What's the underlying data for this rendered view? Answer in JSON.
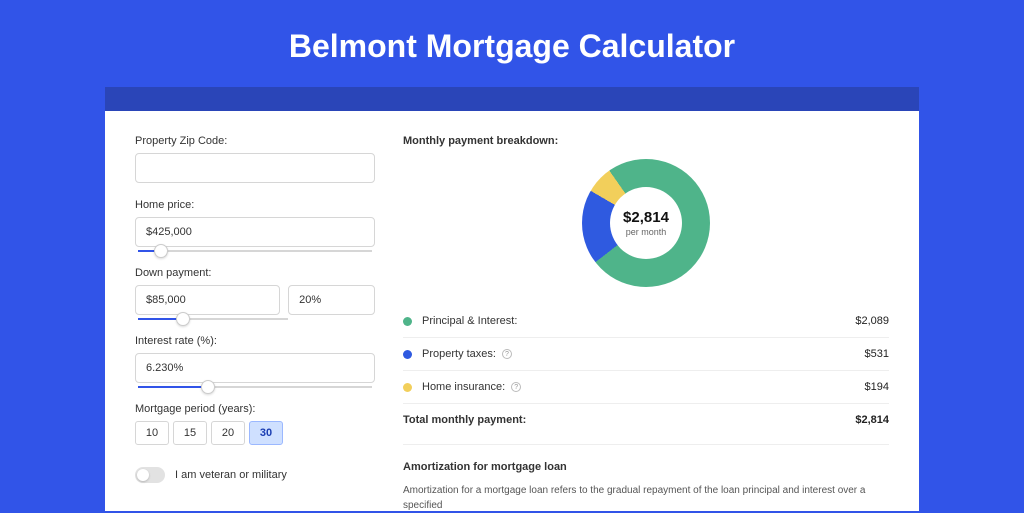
{
  "title": "Belmont Mortgage Calculator",
  "form": {
    "zip": {
      "label": "Property Zip Code:",
      "value": ""
    },
    "home_price": {
      "label": "Home price:",
      "value": "$425,000",
      "slider_pct": 10
    },
    "down_payment": {
      "label": "Down payment:",
      "value": "$85,000",
      "percent_value": "20%",
      "slider_pct": 20
    },
    "interest_rate": {
      "label": "Interest rate (%):",
      "value": "6.230%",
      "slider_pct": 30
    },
    "period": {
      "label": "Mortgage period (years):",
      "options": [
        "10",
        "15",
        "20",
        "30"
      ],
      "selected": "30"
    },
    "veteran": {
      "label": "I am veteran or military",
      "on": false
    }
  },
  "breakdown": {
    "title": "Monthly payment breakdown:",
    "center_amount": "$2,814",
    "center_sub": "per month",
    "items": [
      {
        "label": "Principal & Interest:",
        "value": "$2,089",
        "color": "#4fb48a",
        "info": false
      },
      {
        "label": "Property taxes:",
        "value": "$531",
        "color": "#2f5ae0",
        "info": true
      },
      {
        "label": "Home insurance:",
        "value": "$194",
        "color": "#f2cf5b",
        "info": true
      }
    ],
    "total_label": "Total monthly payment:",
    "total_value": "$2,814"
  },
  "chart_data": {
    "type": "pie",
    "title": "Monthly payment breakdown",
    "series": [
      {
        "name": "Principal & Interest",
        "value": 2089,
        "color": "#4fb48a"
      },
      {
        "name": "Property taxes",
        "value": 531,
        "color": "#2f5ae0"
      },
      {
        "name": "Home insurance",
        "value": 194,
        "color": "#f2cf5b"
      }
    ],
    "total": 2814,
    "unit": "USD/month"
  },
  "amortization": {
    "title": "Amortization for mortgage loan",
    "text": "Amortization for a mortgage loan refers to the gradual repayment of the loan principal and interest over a specified"
  }
}
